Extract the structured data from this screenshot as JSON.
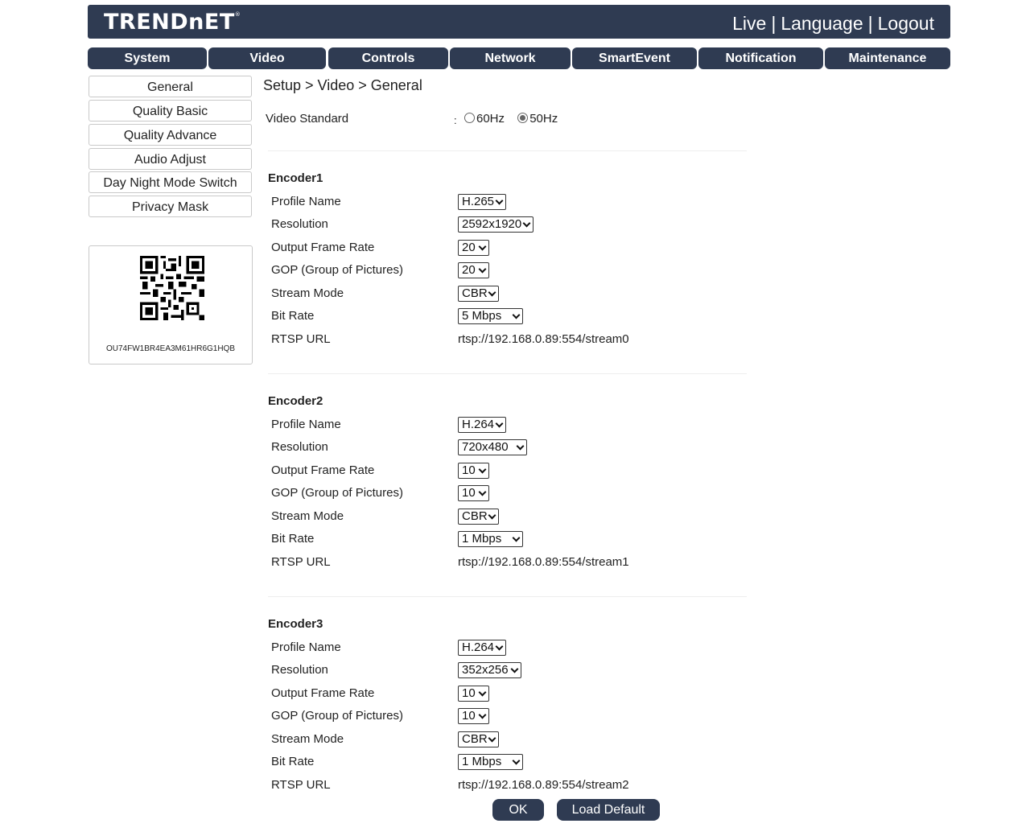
{
  "header": {
    "logo": "TRENDnET",
    "logo_tm": "®",
    "links": [
      "Live",
      "Language",
      "Logout"
    ],
    "separator": "|"
  },
  "nav": {
    "tabs": [
      "System",
      "Video",
      "Controls",
      "Network",
      "SmartEvent",
      "Notification",
      "Maintenance"
    ]
  },
  "sidebar": {
    "items": [
      "General",
      "Quality Basic",
      "Quality Advance",
      "Audio Adjust",
      "Day Night Mode Switch",
      "Privacy Mask"
    ],
    "qr_code_text": "OU74FW1BR4EA3M61HR6G1HQB"
  },
  "breadcrumb": "Setup > Video > General",
  "video_standard": {
    "label": "Video Standard",
    "colon": ":",
    "options": [
      "60Hz",
      "50Hz"
    ],
    "selected": "50Hz"
  },
  "field_labels": {
    "profile": "Profile Name",
    "resolution": "Resolution",
    "frame_rate": "Output Frame Rate",
    "gop": "GOP (Group of Pictures)",
    "stream_mode": "Stream Mode",
    "bit_rate": "Bit Rate",
    "rtsp": "RTSP URL"
  },
  "encoders": [
    {
      "title": "Encoder1",
      "profile": "H.265",
      "resolution": "2592x1920",
      "frame_rate": "20",
      "gop": "20",
      "stream_mode": "CBR",
      "bit_rate": "5 Mbps",
      "rtsp": "rtsp://192.168.0.89:554/stream0"
    },
    {
      "title": "Encoder2",
      "profile": "H.264",
      "resolution": "720x480",
      "frame_rate": "10",
      "gop": "10",
      "stream_mode": "CBR",
      "bit_rate": "1 Mbps",
      "rtsp": "rtsp://192.168.0.89:554/stream1"
    },
    {
      "title": "Encoder3",
      "profile": "H.264",
      "resolution": "352x256",
      "frame_rate": "10",
      "gop": "10",
      "stream_mode": "CBR",
      "bit_rate": "1 Mbps",
      "rtsp": "rtsp://192.168.0.89:554/stream2"
    }
  ],
  "buttons": {
    "ok": "OK",
    "load_default": "Load Default"
  },
  "colors": {
    "brand_navy": "#2f3b52"
  }
}
